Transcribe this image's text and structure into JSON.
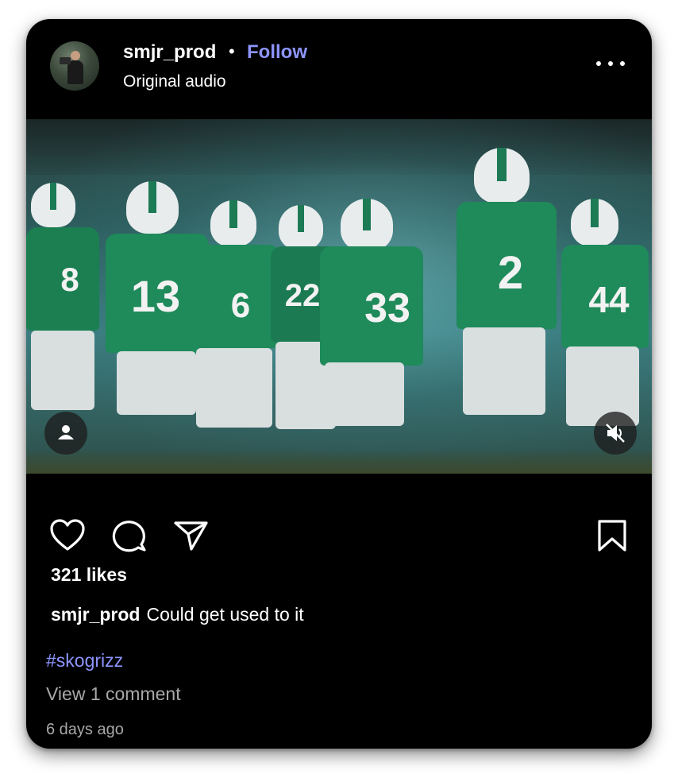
{
  "post": {
    "username": "smjr_prod",
    "separator": "•",
    "follow_label": "Follow",
    "audio_label": "Original audio",
    "more_icon": "more-horizontal-icon",
    "likes": "321 likes",
    "caption_user": "smjr_prod",
    "caption_text": "Could get used to it",
    "hashtag": "#skogrizz",
    "view_comments": "View 1 comment",
    "timestamp": "6 days ago"
  },
  "media": {
    "jersey_numbers": [
      "8",
      "13",
      "6",
      "22",
      "33",
      "2",
      "44"
    ],
    "user_tag_icon": "person-icon",
    "mute_icon": "speaker-muted-icon"
  },
  "actions": {
    "like_icon": "heart-icon",
    "comment_icon": "comment-bubble-icon",
    "share_icon": "paper-plane-icon",
    "save_icon": "bookmark-icon"
  },
  "colors": {
    "background": "#000000",
    "accent_link": "#8d95ff",
    "secondary_text": "#a8a8a8",
    "jersey_green": "#1f8a5a"
  }
}
